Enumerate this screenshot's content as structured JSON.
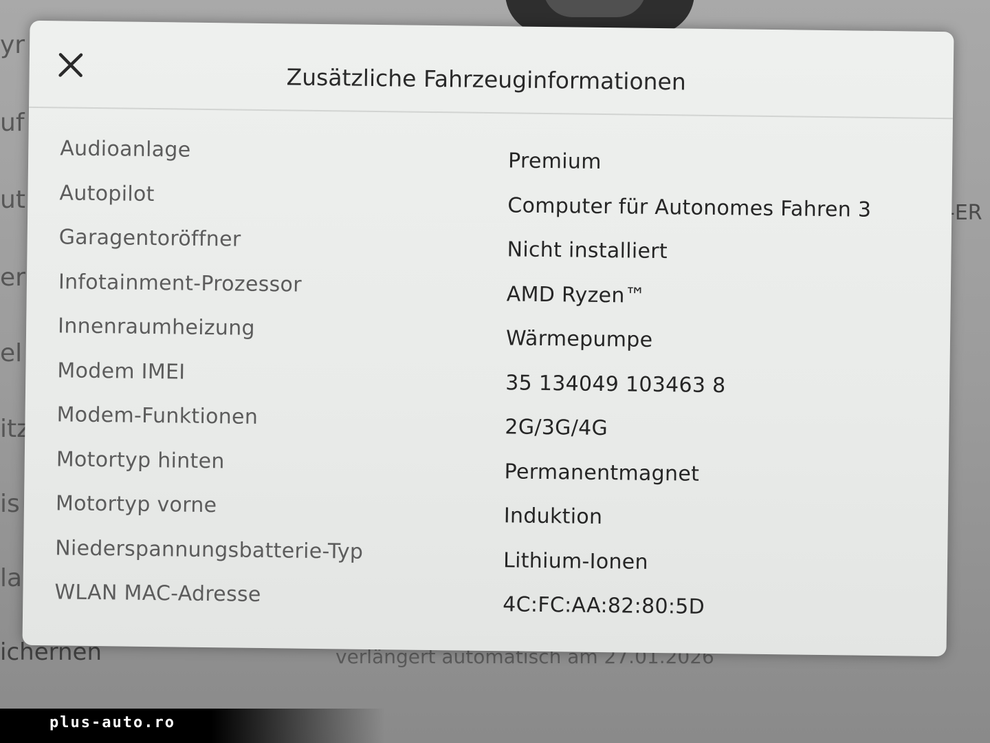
{
  "background": {
    "left_fragments": [
      "yr",
      "uf",
      "ut",
      "er",
      "el",
      "itz",
      "is",
      "lar"
    ],
    "right_fragment": "-ER",
    "bottom_left_fragment": "ichernen",
    "bottom_center_fragment": "verlängert automatisch am 27.01.2026"
  },
  "modal": {
    "title": "Zusätzliche Fahrzeuginformationen",
    "close_icon": "close-icon",
    "rows": [
      {
        "label": "Audioanlage",
        "value": "Premium"
      },
      {
        "label": "Autopilot",
        "value": "Computer für Autonomes Fahren 3"
      },
      {
        "label": "Garagentoröffner",
        "value": "Nicht installiert"
      },
      {
        "label": "Infotainment-Prozessor",
        "value": "AMD Ryzen™"
      },
      {
        "label": "Innenraumheizung",
        "value": "Wärmepumpe"
      },
      {
        "label": "Modem IMEI",
        "value": "35 134049 103463 8"
      },
      {
        "label": "Modem-Funktionen",
        "value": "2G/3G/4G"
      },
      {
        "label": "Motortyp hinten",
        "value": "Permanentmagnet"
      },
      {
        "label": "Motortyp vorne",
        "value": "Induktion"
      },
      {
        "label": "Niederspannungsbatterie-Typ",
        "value": "Lithium-Ionen"
      },
      {
        "label": "WLAN MAC-Adresse",
        "value": "4C:FC:AA:82:80:5D"
      }
    ]
  },
  "watermark": {
    "text": "plus-auto.ro"
  }
}
